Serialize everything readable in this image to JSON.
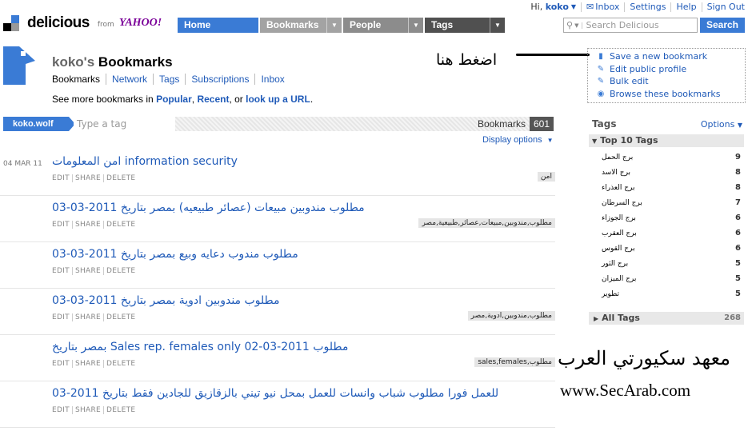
{
  "top_links": {
    "greeting": "Hi,",
    "username": "koko",
    "inbox": "Inbox",
    "settings": "Settings",
    "help": "Help",
    "signout": "Sign Out"
  },
  "brand": {
    "name": "delicious",
    "from": "from",
    "partner": "YAHOO!"
  },
  "nav": [
    {
      "label": "Home",
      "color": "#3a7bd5",
      "has_arrow": false
    },
    {
      "label": "Bookmarks",
      "color": "#9a9a9a",
      "has_arrow": true
    },
    {
      "label": "People",
      "color": "#8a8a8a",
      "has_arrow": true
    },
    {
      "label": "Tags",
      "color": "#555555",
      "has_arrow": true
    }
  ],
  "search": {
    "placeholder": "Search Delicious",
    "button": "Search"
  },
  "header": {
    "user_prefix": "koko's",
    "title_word": "Bookmarks",
    "subnav": [
      "Bookmarks",
      "Network",
      "Tags",
      "Subscriptions",
      "Inbox"
    ],
    "see_more_prefix": "See more bookmarks in",
    "popular": "Popular",
    "recent": "Recent",
    "or": ", or",
    "lookup": "look up a URL",
    "period": "."
  },
  "annotation": {
    "hint_text": "اضغط هنا"
  },
  "actions": [
    {
      "label": "Save a new bookmark",
      "icon": "bookmark-icon"
    },
    {
      "label": "Edit public profile",
      "icon": "pencil-icon"
    },
    {
      "label": "Bulk edit",
      "icon": "pencil-icon"
    },
    {
      "label": "Browse these bookmarks",
      "icon": "eye-icon"
    }
  ],
  "filter": {
    "user": "koko.wolf",
    "tag_placeholder": "Type a tag",
    "count_label": "Bookmarks",
    "count": "601",
    "display_options": "Display options"
  },
  "bookmarks": [
    {
      "date": "04 MAR 11",
      "title": "امن المعلومات information security",
      "tag": "امن"
    },
    {
      "date": "",
      "title": "مطلوب مندوبين مبيعات (عصائر طبيعيه) بمصر بتاريخ 2011-03-03",
      "tag": "مطلوب,مندوبين,مبيعات,عصائر,طبيعية,مصر"
    },
    {
      "date": "",
      "title": "مطلوب مندوب دعايه وبيع بمصر بتاريخ 2011-03-03",
      "tag": ""
    },
    {
      "date": "",
      "title": "مطلوب مندوبين ادوية بمصر بتاريخ 2011-03-03",
      "tag": "مطلوب,مندوبين,ادوية,مصر"
    },
    {
      "date": "",
      "title": "مطلوب Sales rep. females only 02-03-2011 بمصر بتاريخ",
      "tag": "مطلوب,sales,females"
    },
    {
      "date": "",
      "title": "للعمل فورا مطلوب شباب وانسات للعمل بمحل نيو تيني بالزقازيق للجادين فقط بتاريخ 2011-03",
      "tag": ""
    }
  ],
  "bookmark_actions": {
    "edit": "EDIT",
    "share": "SHARE",
    "delete": "DELETE"
  },
  "sidebar": {
    "title": "Tags",
    "options": "Options",
    "top10": "Top 10 Tags",
    "tags": [
      {
        "name": "برج الحمل",
        "count": "9"
      },
      {
        "name": "برج الاسد",
        "count": "8"
      },
      {
        "name": "برج العذراء",
        "count": "8"
      },
      {
        "name": "برج السرطان",
        "count": "7"
      },
      {
        "name": "برج الجوزاء",
        "count": "6"
      },
      {
        "name": "برج العقرب",
        "count": "6"
      },
      {
        "name": "برج القوس",
        "count": "6"
      },
      {
        "name": "برج الثور",
        "count": "5"
      },
      {
        "name": "برج الميزان",
        "count": "5"
      },
      {
        "name": "تطوير",
        "count": "5"
      }
    ],
    "all_tags": "All Tags",
    "all_count": "268"
  },
  "watermark": {
    "arabic": "معهد سكيورتي العرب",
    "url": "www.SecArab.com"
  }
}
